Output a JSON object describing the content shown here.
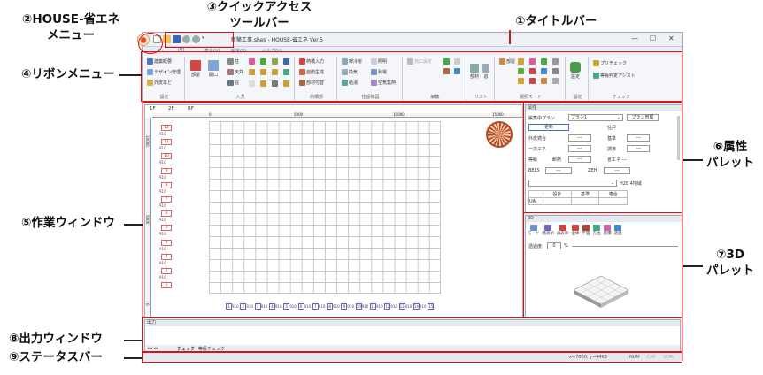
{
  "annotations": {
    "a1": "①タイトルバー",
    "a2_line1": "②HOUSE-省エネ",
    "a2_line2": "メニュー",
    "a3_line1": "③クイックアクセス",
    "a3_line2": "ツールバー",
    "a4": "④リボンメニュー",
    "a5": "⑤作業ウィンドウ",
    "a6_line1": "⑥属性",
    "a6_line2": "パレット",
    "a7_line1": "⑦3D",
    "a7_line2": "パレット",
    "a8": "⑧出力ウィンドウ",
    "a9": "⑨ステータスバー"
  },
  "window": {
    "title": "新築工事.shes - HOUSE-省エネ Ver.5",
    "controls": [
      "—",
      "☐",
      "✕"
    ]
  },
  "tabs": [
    "ル",
    "(V)",
    "表示(V)",
    "設定(S)",
    "ヘルプ(H)"
  ],
  "ribbon": {
    "groups": [
      {
        "label": "設定",
        "items": [
          "建築概要",
          "デザイン管理",
          "外皮準ど"
        ]
      },
      {
        "label": "入力",
        "items": [
          "部屋",
          "開口",
          "柱",
          "天井",
          "欠",
          "庇"
        ]
      },
      {
        "label": "熱橋部",
        "items": [
          "熱橋入力",
          "自動生成",
          "部材付替"
        ]
      },
      {
        "label": "住設機器",
        "items": [
          "暖冷房",
          "換気",
          "給湯",
          "照明",
          "発電",
          "空気集熱"
        ]
      },
      {
        "label": "編集",
        "items": [
          "元に戻す"
        ]
      },
      {
        "label": "リスト",
        "items": [
          "部材",
          "窓"
        ]
      },
      {
        "label": "選択モード",
        "items": [
          "部屋"
        ]
      },
      {
        "label": "設定",
        "items": [
          "設定"
        ]
      },
      {
        "label": "チェック",
        "items": [
          "プリチェック",
          "等級判定アシスト"
        ]
      }
    ]
  },
  "workspace": {
    "floors": [
      "1F",
      "2F",
      "RF"
    ],
    "ruler_top": [
      "0",
      "5000",
      "10000",
      "15000"
    ],
    "ruler_left": [
      "10000",
      "5000",
      "0"
    ],
    "rows": [
      {
        "num": "12",
        "dim": "910"
      },
      {
        "num": "11",
        "dim": "910"
      },
      {
        "num": "10",
        "dim": "910"
      },
      {
        "num": "9",
        "dim": "910"
      },
      {
        "num": "8",
        "dim": "910"
      },
      {
        "num": "7",
        "dim": "910"
      },
      {
        "num": "6",
        "dim": "910"
      },
      {
        "num": "5",
        "dim": "910"
      },
      {
        "num": "4",
        "dim": "910"
      },
      {
        "num": "3",
        "dim": "910"
      },
      {
        "num": "2",
        "dim": "910"
      },
      {
        "num": "1",
        "dim": ""
      }
    ],
    "cols": [
      {
        "num": "1",
        "dim": "910"
      },
      {
        "num": "2",
        "dim": "910"
      },
      {
        "num": "3",
        "dim": "910"
      },
      {
        "num": "4",
        "dim": "910"
      },
      {
        "num": "5",
        "dim": "910"
      },
      {
        "num": "6",
        "dim": "910"
      },
      {
        "num": "7",
        "dim": "910"
      },
      {
        "num": "8",
        "dim": "910"
      },
      {
        "num": "9",
        "dim": "910"
      },
      {
        "num": "10",
        "dim": "910"
      },
      {
        "num": "11",
        "dim": "910"
      },
      {
        "num": "12",
        "dim": "910"
      },
      {
        "num": "13",
        "dim": "910"
      },
      {
        "num": "14",
        "dim": "910"
      },
      {
        "num": "15",
        "dim": ""
      }
    ]
  },
  "attr_palette": {
    "title": "属性",
    "plan_label": "編集中プラン",
    "plan_value": "プラン1",
    "plan_button": "プラン管理",
    "update_button": "更新",
    "rows": [
      {
        "label": "外皮適合",
        "value": "---",
        "label2": "基準",
        "value2": "---"
      },
      {
        "label": "一次エネ",
        "value": "---",
        "label2": "誘導",
        "value2": "---"
      },
      {
        "label": "等級",
        "value": "断熱",
        "label2": "---",
        "value2": "省エネ ---"
      }
    ],
    "bels_label": "BELS",
    "bels_value": "---",
    "zeh_label": "ZEH",
    "zeh_value": "---",
    "dropdown_value": "H28 4地域",
    "table_headers": [
      "",
      "設計",
      "基準",
      "適合"
    ],
    "table_row": [
      "UA",
      "",
      "",
      ""
    ],
    "residence_label": "住戸"
  },
  "p3d": {
    "title": "3D",
    "buttons": [
      "モード",
      "階表示",
      "再表示",
      "全体",
      "平面",
      "方位",
      "座標",
      "透過"
    ],
    "transparency_label": "透過度:",
    "transparency_value": "0",
    "percent": "%"
  },
  "output": {
    "title": "出力",
    "tabs": [
      "チェック",
      "等級チェック"
    ]
  },
  "status": {
    "coords": "x=7060, y=4463",
    "flags": [
      "NUM",
      "CAP",
      "SCRL"
    ]
  }
}
